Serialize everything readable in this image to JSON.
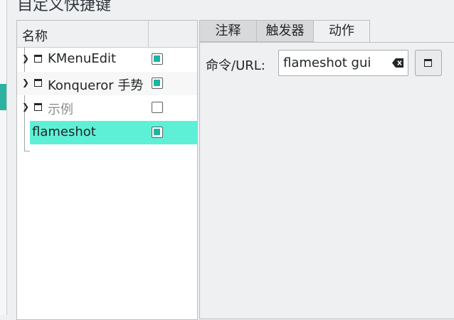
{
  "window": {
    "title": "自定义快捷键"
  },
  "tree": {
    "header": {
      "name": "名称"
    },
    "items": [
      {
        "label": "KMenuEdit",
        "checked": true,
        "icon": "folder-icon",
        "expander": "chevron-right-icon"
      },
      {
        "label": "Konqueror 手势",
        "checked": true,
        "icon": "folder-icon",
        "expander": "chevron-right-icon"
      },
      {
        "label": "示例",
        "checked": false,
        "icon": "folder-icon",
        "expander": "chevron-right-icon"
      },
      {
        "label": "flameshot",
        "checked": true,
        "selected": true
      }
    ]
  },
  "tabs": [
    {
      "label": "注释"
    },
    {
      "label": "触发器"
    },
    {
      "label": "动作",
      "active": true
    }
  ],
  "action": {
    "command_label": "命令/URL:",
    "command_value": "flameshot gui"
  },
  "colors": {
    "accent": "#1db4a0",
    "selection": "#5ef0d6"
  }
}
